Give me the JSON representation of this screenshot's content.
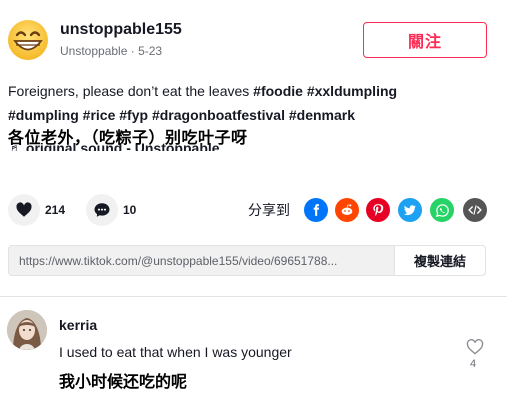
{
  "post": {
    "username": "unstoppable155",
    "display_name": "Unstoppable",
    "date": "5-23",
    "follow_label": "關注",
    "caption_text": "Foreigners, please don’t eat the leaves ",
    "hashtags_line1": [
      "#foodie",
      "#xxldumpling"
    ],
    "hashtags_line2": [
      "#dumpling",
      "#rice",
      "#fyp",
      "#dragonboatfestival",
      "#denmark"
    ],
    "overlay_text": "各位老外，（吃粽子）别吃叶子呀",
    "music": "♬ original sound - Unstoppable"
  },
  "actions": {
    "likes": "214",
    "comments": "10",
    "share_label": "分享到"
  },
  "share_icons": [
    "facebook-icon",
    "reddit-icon",
    "pinterest-icon",
    "twitter-icon",
    "whatsapp-icon",
    "embed-icon"
  ],
  "colors": {
    "accent": "#fe2c55",
    "facebook": "#0075fa",
    "reddit": "#ff4500",
    "pinterest": "#e60023",
    "twitter": "#1da1f2",
    "whatsapp": "#25d366",
    "embed": "#555555"
  },
  "link": {
    "url": "https://www.tiktok.com/@unstoppable155/video/69651788...",
    "copy_label": "複製連結"
  },
  "comment": {
    "username": "kerria",
    "text": "I used to eat that when I was younger",
    "overlay_text": "我小时候还吃的呢",
    "likes": "4"
  }
}
